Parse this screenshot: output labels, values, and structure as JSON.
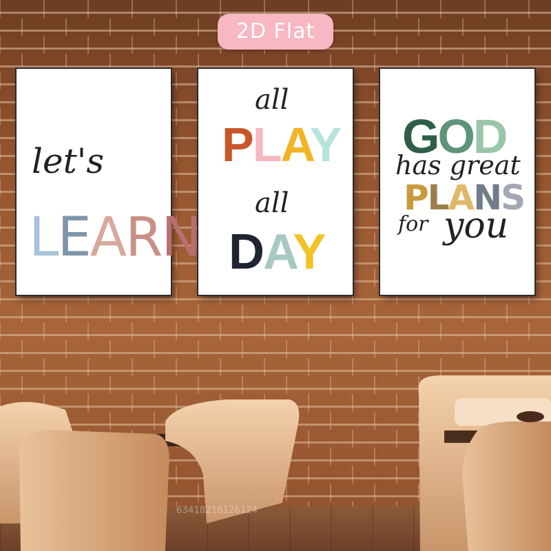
{
  "badge": {
    "label": "2D Flat",
    "color": "#f7b7c3"
  },
  "posters": [
    {
      "script_line": "let's",
      "block_word": "LEARN",
      "block_colors": [
        "#a9c2d6",
        "#7e95aa",
        "#d7a99c",
        "#c98f86",
        "#b96f70"
      ]
    },
    {
      "script_top": "all",
      "word_play": "PLAY",
      "play_colors": [
        "#c9562a",
        "#f6b7c0",
        "#f2b424",
        "#b6e3dc"
      ],
      "script_mid": "all",
      "word_day": "DAY",
      "day_colors": [
        "#1f2433",
        "#a6c9c4",
        "#f2c226"
      ]
    },
    {
      "word_god": "GOD",
      "god_colors": [
        "#2f5e47",
        "#5e9478",
        "#9bc5a9"
      ],
      "script_line1": "has great",
      "word_plans": "PLANS",
      "plans_colors": [
        "#c99a3d",
        "#9a7f4b",
        "#e0b86b",
        "#707c8a",
        "#a3a6b4"
      ],
      "script_for": "for",
      "script_you": "you"
    }
  ],
  "watermark": "63418216126124"
}
